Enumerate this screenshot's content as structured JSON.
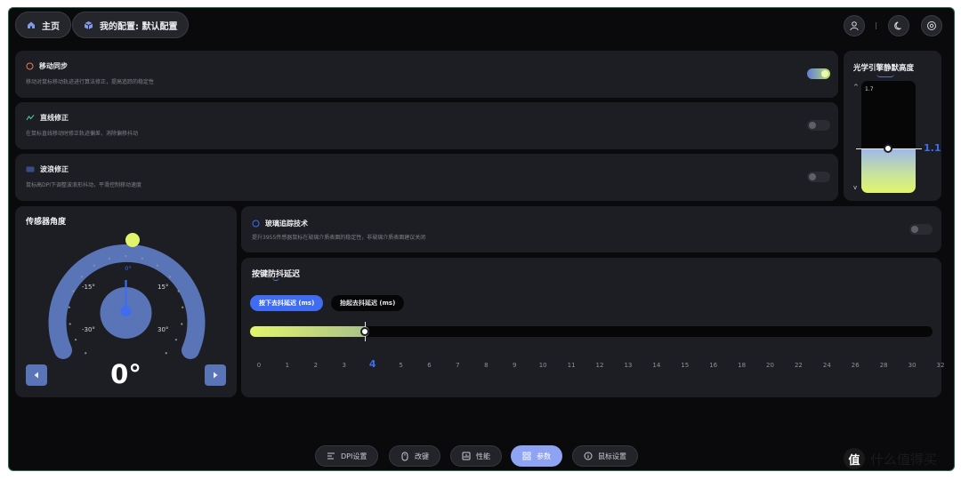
{
  "header": {
    "home_label": "主页",
    "config_label": "我的配置: 默认配置"
  },
  "settings": [
    {
      "title": "移动同步",
      "desc": "移动对鼠标移动轨迹进行算法修正，提高追踪的稳定性",
      "enabled": true
    },
    {
      "title": "直线修正",
      "desc": "在鼠标直线移动时修正轨迹偏差，消除偏移抖动",
      "enabled": false
    },
    {
      "title": "波浪修正",
      "desc": "鼠标高DPI下调整波浪形抖动，平滑控制移动速度",
      "enabled": false
    }
  ],
  "lod": {
    "title": "光学引擎静默高度",
    "max_label": "1.7",
    "current_value": "1.1",
    "level_fraction": 0.4
  },
  "sensor": {
    "title": "传感器角度",
    "scale_labels": [
      "0°",
      "-15°",
      "15°",
      "-30°",
      "30°"
    ],
    "value": "0°"
  },
  "glass": {
    "title": "玻璃追踪技术",
    "desc": "提升3955传感器鼠标在玻璃介质表面的稳定性，非玻璃介质表面建议关闭",
    "enabled": false
  },
  "debounce": {
    "title": "按键防抖延迟",
    "tab_press": "按下去抖延迟 (ms)",
    "tab_release": "抬起去抖延迟 (ms)",
    "ticks": [
      "0",
      "1",
      "2",
      "3",
      "4",
      "5",
      "6",
      "7",
      "8",
      "9",
      "10",
      "11",
      "12",
      "13",
      "14",
      "15",
      "16",
      "18",
      "20",
      "22",
      "24",
      "26",
      "28",
      "30",
      "32"
    ],
    "value": 4
  },
  "nav": [
    {
      "label": "DPI设置",
      "icon": "dpi-icon"
    },
    {
      "label": "改键",
      "icon": "mouse-icon"
    },
    {
      "label": "性能",
      "icon": "performance-icon"
    },
    {
      "label": "参数",
      "icon": "grid-icon"
    },
    {
      "label": "鼠标设置",
      "icon": "info-icon"
    }
  ],
  "watermark": {
    "text": "什么值得买",
    "logo_char": "值"
  },
  "colors": {
    "accent": "#3f6cf0",
    "gauge": "#5a74b8",
    "lime": "#e2f56a"
  }
}
